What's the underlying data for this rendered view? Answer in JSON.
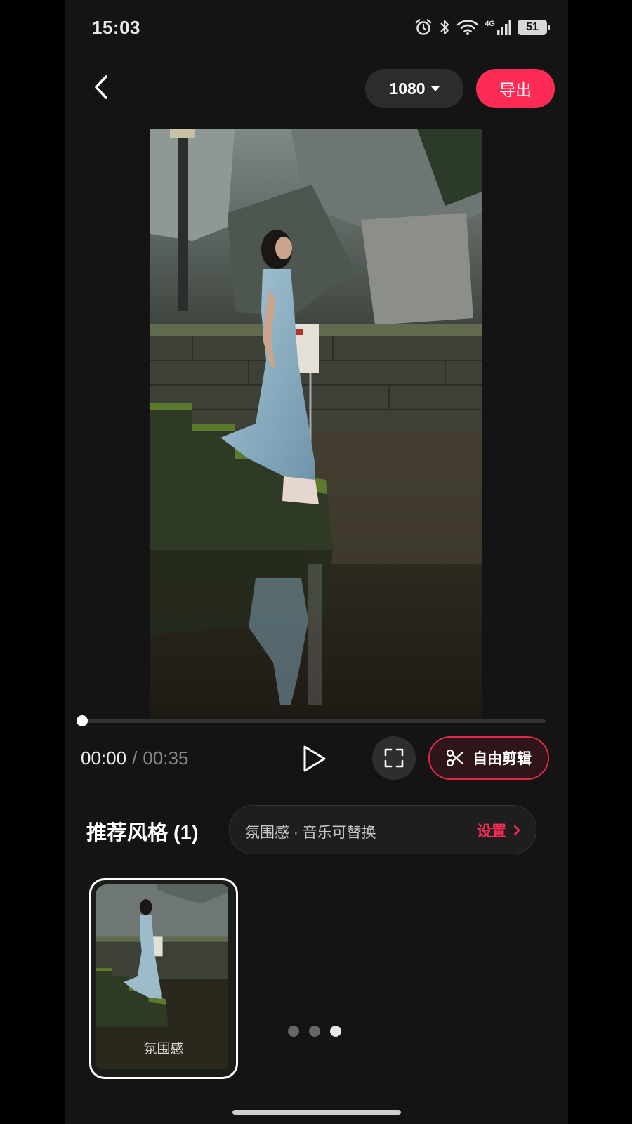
{
  "status_bar": {
    "time": "15:03",
    "network_label": "4G",
    "battery_level": "51",
    "icons": [
      "alarm-icon",
      "bluetooth-icon",
      "wifi-icon",
      "signal-icon",
      "battery-icon"
    ]
  },
  "header": {
    "back_icon": "chevron-left-icon",
    "resolution": "1080",
    "export_label": "导出"
  },
  "player": {
    "current_time": "00:00",
    "separator": "/",
    "total_time": "00:35",
    "progress": 0,
    "play_icon": "play-icon",
    "fullscreen_icon": "fullscreen-icon",
    "free_edit_label": "自由剪辑",
    "free_edit_icon": "scissors-icon"
  },
  "styles": {
    "title": "推荐风格 (1)",
    "info_text": "氛围感 · 音乐可替换",
    "settings_label": "设置",
    "items": [
      {
        "label": "氛围感",
        "selected": true
      }
    ],
    "pagination": {
      "total": 3,
      "active": 3
    }
  },
  "colors": {
    "accent": "#fe2c55",
    "background": "#141414",
    "pill": "#2c2c2c"
  }
}
